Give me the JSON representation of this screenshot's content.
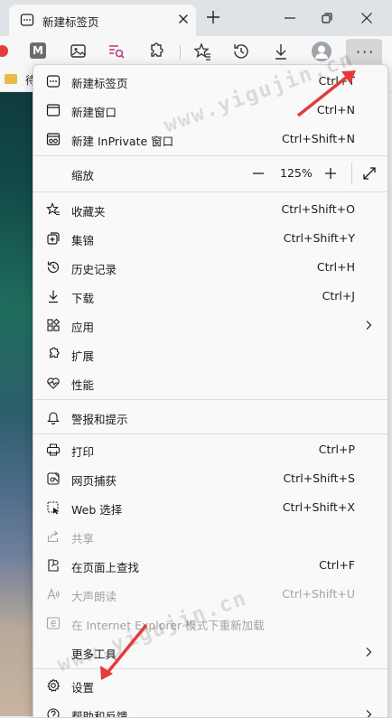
{
  "tab": {
    "title": "新建标签页"
  },
  "favorites_bar": {
    "first_item": "待"
  },
  "watermark": "www.yigujin.cn",
  "menu": {
    "items": [
      {
        "label": "新建标签页",
        "shortcut": "Ctrl+T",
        "icon": "new-tab-icon"
      },
      {
        "label": "新建窗口",
        "shortcut": "Ctrl+N",
        "icon": "new-window-icon"
      },
      {
        "label": "新建 InPrivate 窗口",
        "shortcut": "Ctrl+Shift+N",
        "icon": "inprivate-icon"
      },
      {
        "label": "缩放",
        "zoom_value": "125%",
        "icon": ""
      },
      {
        "label": "收藏夹",
        "shortcut": "Ctrl+Shift+O",
        "icon": "favorites-icon"
      },
      {
        "label": "集锦",
        "shortcut": "Ctrl+Shift+Y",
        "icon": "collections-icon"
      },
      {
        "label": "历史记录",
        "shortcut": "Ctrl+H",
        "icon": "history-icon"
      },
      {
        "label": "下载",
        "shortcut": "Ctrl+J",
        "icon": "download-icon"
      },
      {
        "label": "应用",
        "shortcut": "",
        "icon": "apps-icon"
      },
      {
        "label": "扩展",
        "shortcut": "",
        "icon": "extensions-icon"
      },
      {
        "label": "性能",
        "shortcut": "",
        "icon": "performance-icon"
      },
      {
        "label": "警报和提示",
        "shortcut": "",
        "icon": "bell-icon"
      },
      {
        "label": "打印",
        "shortcut": "Ctrl+P",
        "icon": "print-icon"
      },
      {
        "label": "网页捕获",
        "shortcut": "Ctrl+Shift+S",
        "icon": "web-capture-icon"
      },
      {
        "label": "Web 选择",
        "shortcut": "Ctrl+Shift+X",
        "icon": "web-select-icon"
      },
      {
        "label": "共享",
        "shortcut": "",
        "icon": "share-icon"
      },
      {
        "label": "在页面上查找",
        "shortcut": "Ctrl+F",
        "icon": "find-icon"
      },
      {
        "label": "大声朗读",
        "shortcut": "Ctrl+Shift+U",
        "icon": "read-aloud-icon"
      },
      {
        "label": "在 Internet Explorer 模式下重新加载",
        "shortcut": "",
        "icon": "ie-icon"
      },
      {
        "label": "更多工具",
        "shortcut": "",
        "icon": ""
      },
      {
        "label": "设置",
        "shortcut": "",
        "icon": "settings-icon"
      },
      {
        "label": "帮助和反馈",
        "shortcut": "",
        "icon": "help-icon"
      }
    ]
  },
  "colors": {
    "menu_bg": "#f9f9f9",
    "disabled_text": "#a3a3a3",
    "annotation_arrow": "#e33b3b"
  }
}
